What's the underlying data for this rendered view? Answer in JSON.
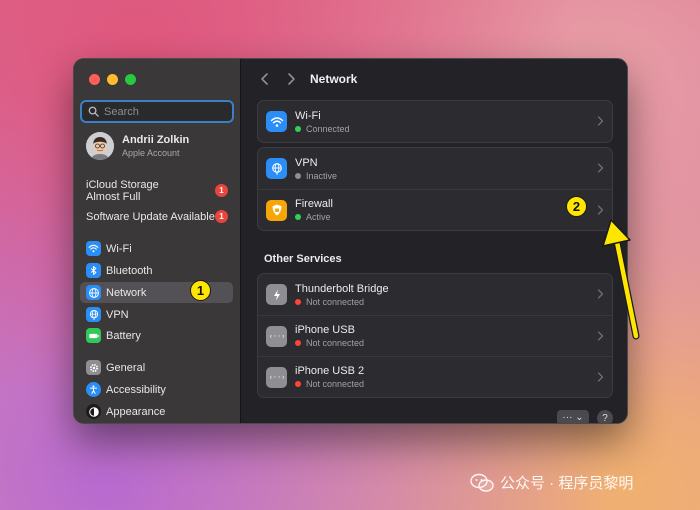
{
  "sidebar": {
    "search_placeholder": "Search",
    "account": {
      "name": "Andrii Zolkin",
      "subtitle": "Apple Account"
    },
    "notices": [
      {
        "label_line1": "iCloud Storage",
        "label_line2": "Almost Full",
        "badge": "1"
      },
      {
        "label": "Software Update Available",
        "badge": "1"
      }
    ],
    "items": [
      {
        "label": "Wi-Fi",
        "icon": "wifi-icon"
      },
      {
        "label": "Bluetooth",
        "icon": "bluetooth-icon"
      },
      {
        "label": "Network",
        "icon": "globe-icon",
        "selected": true
      },
      {
        "label": "VPN",
        "icon": "vpn-globe-icon"
      },
      {
        "label": "Battery",
        "icon": "battery-icon"
      },
      {
        "label": "General",
        "icon": "gear-icon"
      },
      {
        "label": "Accessibility",
        "icon": "accessibility-icon"
      },
      {
        "label": "Appearance",
        "icon": "appearance-icon"
      }
    ]
  },
  "main": {
    "title": "Network",
    "group1": [
      {
        "name": "Wi-Fi",
        "status": "Connected",
        "status_color": "#30d158"
      }
    ],
    "group2": [
      {
        "name": "VPN",
        "status": "Inactive",
        "status_color": "#8e8e93"
      },
      {
        "name": "Firewall",
        "status": "Active",
        "status_color": "#30d158"
      }
    ],
    "section_title": "Other Services",
    "group3": [
      {
        "name": "Thunderbolt Bridge",
        "status": "Not connected",
        "status_color": "#ff453a"
      },
      {
        "name": "iPhone USB",
        "status": "Not connected",
        "status_color": "#ff453a"
      },
      {
        "name": "iPhone USB 2",
        "status": "Not connected",
        "status_color": "#ff453a"
      }
    ],
    "more_label": "··· ⌄",
    "help_label": "?"
  },
  "annotations": {
    "step1": "1",
    "step2": "2"
  },
  "watermark": {
    "text": "公众号 · 程序员黎明"
  },
  "colors": {
    "accent": "#3d7fc4",
    "callout": "#ffe600"
  }
}
